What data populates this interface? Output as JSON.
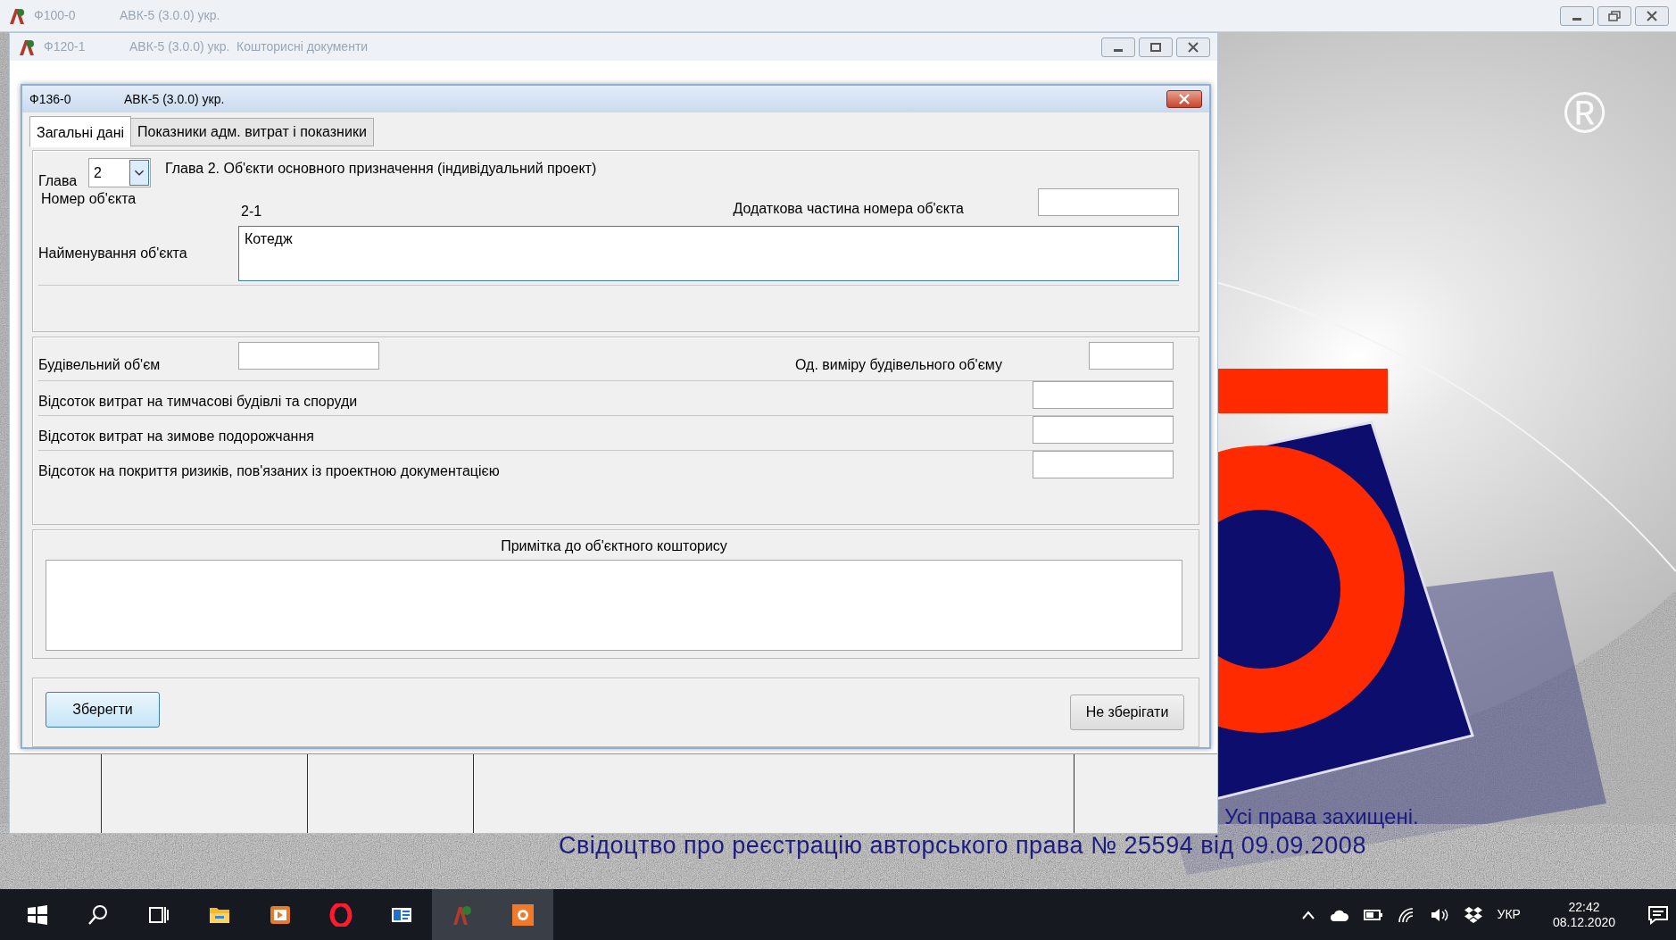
{
  "main_window": {
    "code": "Ф100-0",
    "title": "АВК-5 (3.0.0) укр.",
    "active": false
  },
  "documents_window": {
    "code": "Ф120-1",
    "title": "АВК-5 (3.0.0) укр.  Кошторисні документи",
    "active": false
  },
  "splash": {
    "mark": "®",
    "rights": "Усі права захищені.",
    "certificate": "Свідоцтво про реєстрацію авторського права № 25594 від 09.09.2008"
  },
  "dialog": {
    "code": "Ф136-0",
    "title": "АВК-5 (3.0.0) укр.",
    "active": true,
    "tabs": [
      {
        "label": "Загальні дані",
        "selected": true
      },
      {
        "label": "Показники адм. витрат і показники",
        "selected": false
      }
    ],
    "chapter": {
      "label": "Глава",
      "value": "2",
      "description": "Глава 2. Об'єкти основного призначення (індивідуальний проект)"
    },
    "object_number": {
      "label": "Номер об'єкта",
      "value": "2-1"
    },
    "extra_number": {
      "label": "Додаткова частина номера об'єкта"
    },
    "object_name": {
      "label": "Найменування об'єкта",
      "value": "Котедж"
    },
    "volume": {
      "label": "Будівельний об'єм"
    },
    "volume_unit": {
      "label": "Од. виміру будівельного об'єму"
    },
    "percent_fields": [
      {
        "label": "Відсоток витрат на тимчасові будівлі та споруди"
      },
      {
        "label": "Відсоток витрат на зимове подорожчання"
      },
      {
        "label": "Відсоток на покриття ризиків, пов'язаних із проектною документацією"
      }
    ],
    "note": {
      "label": "Примітка до об'єктного кошторису"
    },
    "buttons": [
      {
        "label": "Зберегти",
        "focused": true
      },
      {
        "label": "Не зберігати",
        "focused": false
      }
    ]
  },
  "taskbar": {
    "apps": [
      {
        "kind": "explorer",
        "active": false
      },
      {
        "kind": "media",
        "active": false
      },
      {
        "kind": "opera",
        "active": false
      },
      {
        "kind": "window",
        "active": false
      },
      {
        "kind": "avk",
        "active": true
      },
      {
        "kind": "capture",
        "active": true
      }
    ],
    "language": "УКР",
    "time": "22:42",
    "date": "08.12.2020"
  }
}
